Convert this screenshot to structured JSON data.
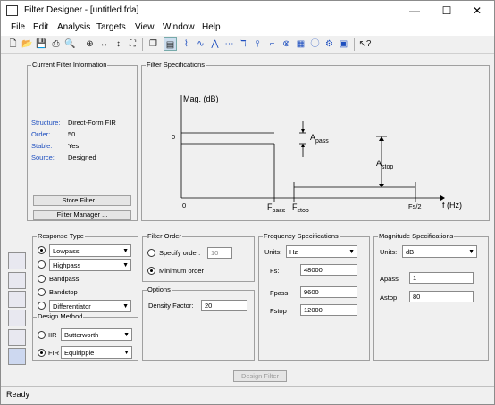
{
  "window": {
    "title": "Filter Designer - [untitled.fda]"
  },
  "menubar": [
    "File",
    "Edit",
    "Analysis",
    "Targets",
    "View",
    "Window",
    "Help"
  ],
  "current_info": {
    "title": "Current Filter Information",
    "structure_label": "Structure:",
    "structure_value": "Direct-Form FIR",
    "order_label": "Order:",
    "order_value": "50",
    "stable_label": "Stable:",
    "stable_value": "Yes",
    "source_label": "Source:",
    "source_value": "Designed",
    "store_button": "Store Filter ...",
    "manager_button": "Filter Manager ..."
  },
  "filter_specs": {
    "title": "Filter Specifications",
    "mag_label": "Mag. (dB)",
    "zero_y": "0",
    "zero_x": "0",
    "apass": "A",
    "apass_sub": "pass",
    "astop": "A",
    "astop_sub": "stop",
    "fpass": "F",
    "fpass_sub": "pass",
    "fstop": "F",
    "fstop_sub": "stop",
    "fs2": "Fs/2",
    "f_axis": "f (Hz)"
  },
  "response_type": {
    "title": "Response Type",
    "lowpass": "Lowpass",
    "highpass": "Highpass",
    "bandpass": "Bandpass",
    "bandstop": "Bandstop",
    "differentiator": "Differentiator"
  },
  "design_method": {
    "title": "Design Method",
    "iir": "IIR",
    "iir_value": "Butterworth",
    "fir": "FIR",
    "fir_value": "Equiripple"
  },
  "filter_order": {
    "title": "Filter Order",
    "specify": "Specify order:",
    "specify_value": "10",
    "minimum": "Minimum order"
  },
  "options": {
    "title": "Options",
    "density_label": "Density Factor:",
    "density_value": "20"
  },
  "freq_specs": {
    "title": "Frequency Specifications",
    "units_label": "Units:",
    "units_value": "Hz",
    "fs_label": "Fs:",
    "fs_value": "48000",
    "fpass_label": "Fpass",
    "fpass_value": "9600",
    "fstop_label": "Fstop",
    "fstop_value": "12000"
  },
  "mag_specs": {
    "title": "Magnitude Specifications",
    "units_label": "Units:",
    "units_value": "dB",
    "apass_label": "Apass",
    "apass_value": "1",
    "astop_label": "Astop",
    "astop_value": "80"
  },
  "design_button": "Design Filter",
  "status": "Ready",
  "colors": {
    "accent": "#1e4fbf",
    "panel_border": "#a0a0a0"
  }
}
